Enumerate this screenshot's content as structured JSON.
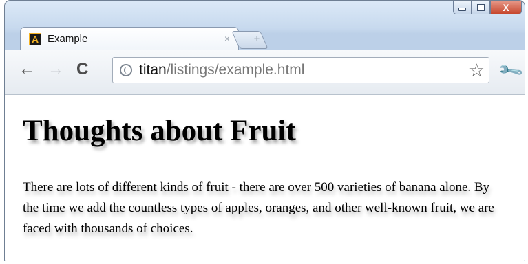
{
  "tab": {
    "title": "Example",
    "close_glyph": "×",
    "favicon_letter": "A",
    "favicon_icon": "letter-a-favicon"
  },
  "newtab": {
    "glyph": "+",
    "icon": "new-tab-icon"
  },
  "toolbar": {
    "back_icon": "back-arrow-icon",
    "forward_icon": "forward-arrow-icon",
    "reload_icon": "reload-icon",
    "back_glyph": "←",
    "forward_glyph": "→",
    "reload_glyph": "C",
    "star_glyph": "☆",
    "wrench_glyph": "🔧"
  },
  "address": {
    "host": "titan",
    "path": "/listings/example.html",
    "icon": "globe-icon"
  },
  "window_controls": {
    "close_glyph": "X",
    "close_color": "#c6462d"
  },
  "page": {
    "heading": "Thoughts about Fruit",
    "paragraph": "There are lots of different kinds of fruit - there are over 500 varieties of banana alone. By the time we add the countless types of apples, oranges, and other well-known fruit, we are faced with thousands of choices."
  }
}
